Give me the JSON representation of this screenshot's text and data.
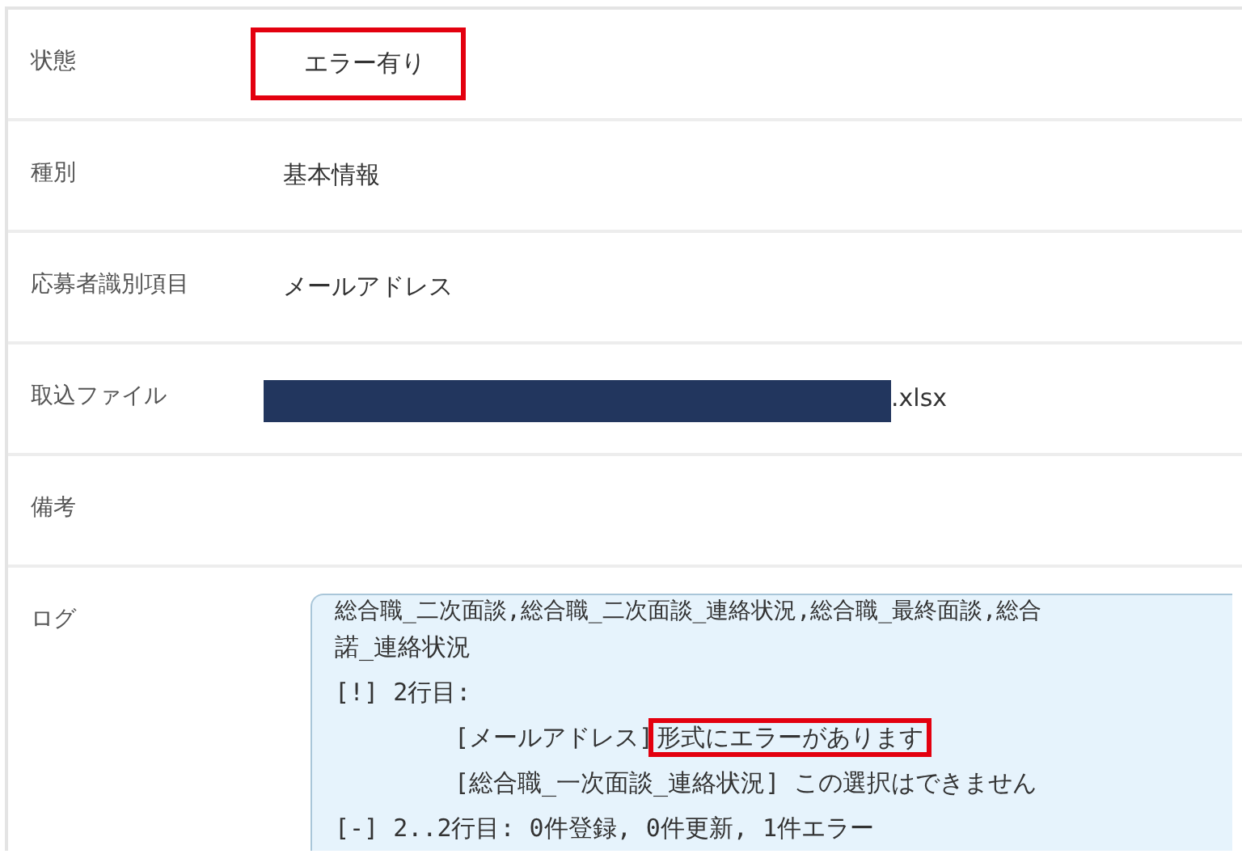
{
  "rows": [
    {
      "label": "状態",
      "kind": "text",
      "value": "エラー有り",
      "highlighted": true
    },
    {
      "label": "種別",
      "kind": "text",
      "value": "基本情報",
      "highlighted": false
    },
    {
      "label": "応募者識別項目",
      "kind": "text",
      "value": "メールアドレス",
      "highlighted": false
    },
    {
      "label": "取込ファイル",
      "kind": "file",
      "redacted": true,
      "value": ".xlsx"
    },
    {
      "label": "備考",
      "kind": "text",
      "value": ""
    },
    {
      "label": "ログ",
      "kind": "log",
      "lines": [
        {
          "segments": [
            {
              "text": "総合職_二次面談,総合職_二次面談_連絡状況,総合職_最終面談,総合",
              "highlighted": false
            }
          ]
        },
        {
          "segments": [
            {
              "text": "諾_連絡状況",
              "highlighted": false
            }
          ]
        },
        {
          "segments": [
            {
              "text": "[!] 2行目:",
              "highlighted": false
            }
          ],
          "children": [
            {
              "segments": [
                {
                  "text": "[メールアドレス]",
                  "highlighted": false
                },
                {
                  "text": "形式にエラーがあります",
                  "highlighted": true
                }
              ]
            },
            {
              "segments": [
                {
                  "text": "[総合職_一次面談_連絡状況] この選択はできません",
                  "highlighted": false
                }
              ]
            }
          ]
        },
        {
          "segments": [
            {
              "text": "[-] 2..2行目: 0件登録, 0件更新, 1件エラー",
              "highlighted": false
            }
          ]
        }
      ]
    }
  ]
}
